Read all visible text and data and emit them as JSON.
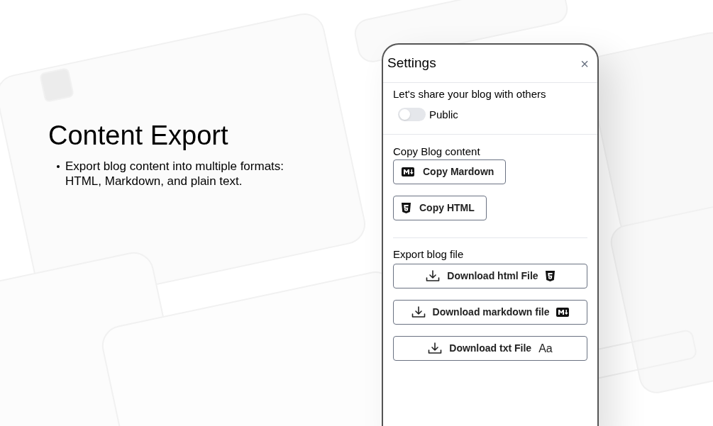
{
  "heading": "Content Export",
  "bullets": [
    "Export blog content into multiple formats: HTML, Markdown, and plain text."
  ],
  "settings": {
    "title": "Settings",
    "close": "×",
    "share_label": "Let's share your blog with others",
    "toggle": {
      "label": "Public",
      "on": false
    },
    "copy_section": {
      "title": "Copy Blog content",
      "buttons": [
        {
          "label": "Copy Mardown",
          "kind": "markdown"
        },
        {
          "label": "Copy HTML",
          "kind": "html"
        }
      ]
    },
    "export_section": {
      "title": "Export blog file",
      "buttons": [
        {
          "label": "Download html File",
          "kind": "html"
        },
        {
          "label": "Download markdown file",
          "kind": "markdown"
        },
        {
          "label": "Download txt File",
          "kind": "text",
          "badge": "Aa"
        }
      ]
    }
  }
}
